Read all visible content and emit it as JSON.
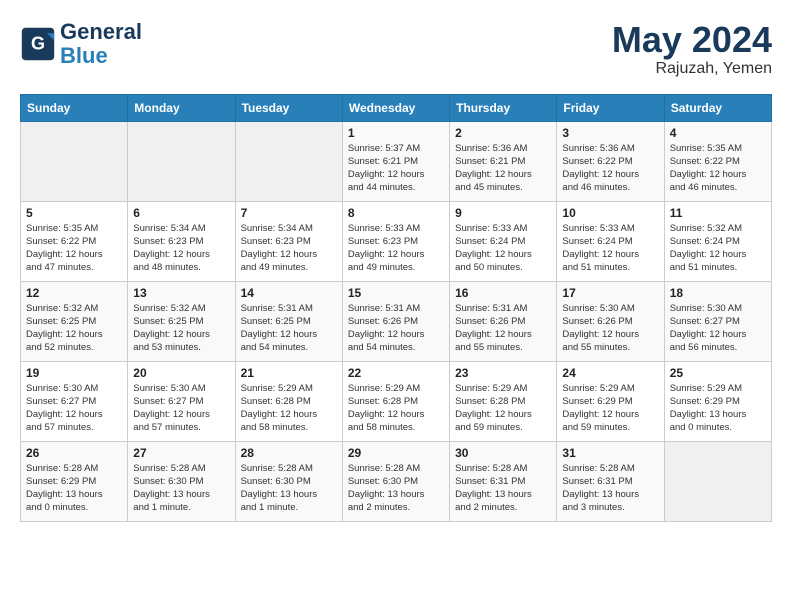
{
  "header": {
    "logo_line1": "General",
    "logo_line2": "Blue",
    "month": "May 2024",
    "location": "Rajuzah, Yemen"
  },
  "weekdays": [
    "Sunday",
    "Monday",
    "Tuesday",
    "Wednesday",
    "Thursday",
    "Friday",
    "Saturday"
  ],
  "weeks": [
    [
      {
        "day": "",
        "info": ""
      },
      {
        "day": "",
        "info": ""
      },
      {
        "day": "",
        "info": ""
      },
      {
        "day": "1",
        "info": "Sunrise: 5:37 AM\nSunset: 6:21 PM\nDaylight: 12 hours\nand 44 minutes."
      },
      {
        "day": "2",
        "info": "Sunrise: 5:36 AM\nSunset: 6:21 PM\nDaylight: 12 hours\nand 45 minutes."
      },
      {
        "day": "3",
        "info": "Sunrise: 5:36 AM\nSunset: 6:22 PM\nDaylight: 12 hours\nand 46 minutes."
      },
      {
        "day": "4",
        "info": "Sunrise: 5:35 AM\nSunset: 6:22 PM\nDaylight: 12 hours\nand 46 minutes."
      }
    ],
    [
      {
        "day": "5",
        "info": "Sunrise: 5:35 AM\nSunset: 6:22 PM\nDaylight: 12 hours\nand 47 minutes."
      },
      {
        "day": "6",
        "info": "Sunrise: 5:34 AM\nSunset: 6:23 PM\nDaylight: 12 hours\nand 48 minutes."
      },
      {
        "day": "7",
        "info": "Sunrise: 5:34 AM\nSunset: 6:23 PM\nDaylight: 12 hours\nand 49 minutes."
      },
      {
        "day": "8",
        "info": "Sunrise: 5:33 AM\nSunset: 6:23 PM\nDaylight: 12 hours\nand 49 minutes."
      },
      {
        "day": "9",
        "info": "Sunrise: 5:33 AM\nSunset: 6:24 PM\nDaylight: 12 hours\nand 50 minutes."
      },
      {
        "day": "10",
        "info": "Sunrise: 5:33 AM\nSunset: 6:24 PM\nDaylight: 12 hours\nand 51 minutes."
      },
      {
        "day": "11",
        "info": "Sunrise: 5:32 AM\nSunset: 6:24 PM\nDaylight: 12 hours\nand 51 minutes."
      }
    ],
    [
      {
        "day": "12",
        "info": "Sunrise: 5:32 AM\nSunset: 6:25 PM\nDaylight: 12 hours\nand 52 minutes."
      },
      {
        "day": "13",
        "info": "Sunrise: 5:32 AM\nSunset: 6:25 PM\nDaylight: 12 hours\nand 53 minutes."
      },
      {
        "day": "14",
        "info": "Sunrise: 5:31 AM\nSunset: 6:25 PM\nDaylight: 12 hours\nand 54 minutes."
      },
      {
        "day": "15",
        "info": "Sunrise: 5:31 AM\nSunset: 6:26 PM\nDaylight: 12 hours\nand 54 minutes."
      },
      {
        "day": "16",
        "info": "Sunrise: 5:31 AM\nSunset: 6:26 PM\nDaylight: 12 hours\nand 55 minutes."
      },
      {
        "day": "17",
        "info": "Sunrise: 5:30 AM\nSunset: 6:26 PM\nDaylight: 12 hours\nand 55 minutes."
      },
      {
        "day": "18",
        "info": "Sunrise: 5:30 AM\nSunset: 6:27 PM\nDaylight: 12 hours\nand 56 minutes."
      }
    ],
    [
      {
        "day": "19",
        "info": "Sunrise: 5:30 AM\nSunset: 6:27 PM\nDaylight: 12 hours\nand 57 minutes."
      },
      {
        "day": "20",
        "info": "Sunrise: 5:30 AM\nSunset: 6:27 PM\nDaylight: 12 hours\nand 57 minutes."
      },
      {
        "day": "21",
        "info": "Sunrise: 5:29 AM\nSunset: 6:28 PM\nDaylight: 12 hours\nand 58 minutes."
      },
      {
        "day": "22",
        "info": "Sunrise: 5:29 AM\nSunset: 6:28 PM\nDaylight: 12 hours\nand 58 minutes."
      },
      {
        "day": "23",
        "info": "Sunrise: 5:29 AM\nSunset: 6:28 PM\nDaylight: 12 hours\nand 59 minutes."
      },
      {
        "day": "24",
        "info": "Sunrise: 5:29 AM\nSunset: 6:29 PM\nDaylight: 12 hours\nand 59 minutes."
      },
      {
        "day": "25",
        "info": "Sunrise: 5:29 AM\nSunset: 6:29 PM\nDaylight: 13 hours\nand 0 minutes."
      }
    ],
    [
      {
        "day": "26",
        "info": "Sunrise: 5:28 AM\nSunset: 6:29 PM\nDaylight: 13 hours\nand 0 minutes."
      },
      {
        "day": "27",
        "info": "Sunrise: 5:28 AM\nSunset: 6:30 PM\nDaylight: 13 hours\nand 1 minute."
      },
      {
        "day": "28",
        "info": "Sunrise: 5:28 AM\nSunset: 6:30 PM\nDaylight: 13 hours\nand 1 minute."
      },
      {
        "day": "29",
        "info": "Sunrise: 5:28 AM\nSunset: 6:30 PM\nDaylight: 13 hours\nand 2 minutes."
      },
      {
        "day": "30",
        "info": "Sunrise: 5:28 AM\nSunset: 6:31 PM\nDaylight: 13 hours\nand 2 minutes."
      },
      {
        "day": "31",
        "info": "Sunrise: 5:28 AM\nSunset: 6:31 PM\nDaylight: 13 hours\nand 3 minutes."
      },
      {
        "day": "",
        "info": ""
      }
    ]
  ]
}
